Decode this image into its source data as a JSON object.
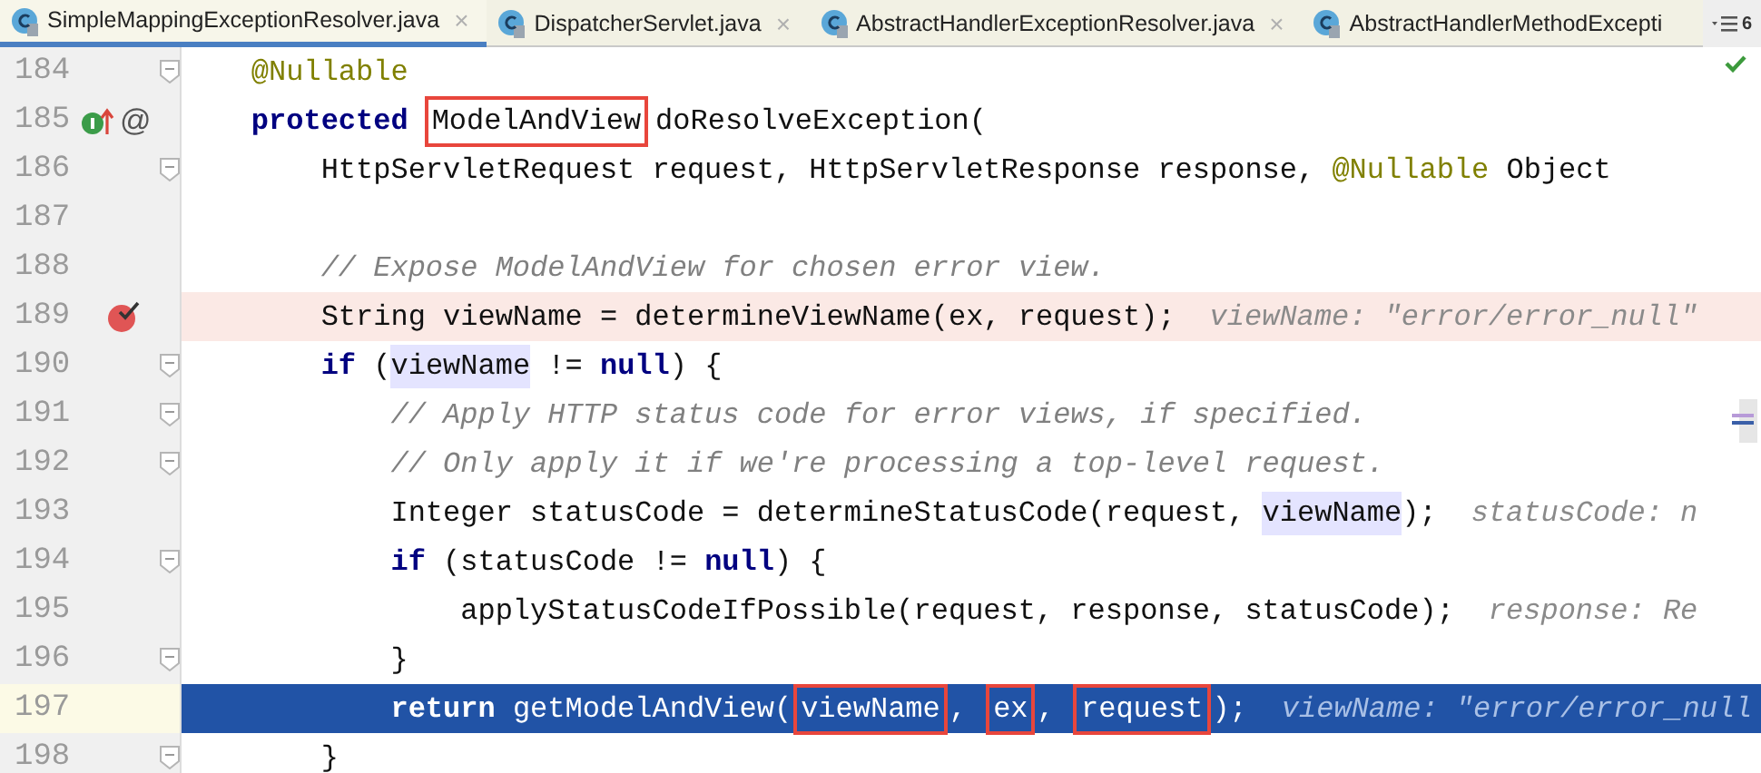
{
  "tabs": [
    {
      "label": "SimpleMappingExceptionResolver.java",
      "selected": true,
      "closable": true
    },
    {
      "label": "DispatcherServlet.java",
      "selected": false,
      "closable": true
    },
    {
      "label": "AbstractHandlerExceptionResolver.java",
      "selected": false,
      "closable": true
    },
    {
      "label": "AbstractHandlerMethodExcepti",
      "selected": false,
      "closable": false
    }
  ],
  "hidden_tab_count": "6",
  "close_glyph": "×",
  "lines": [
    {
      "number": "184",
      "breakpoint": false,
      "current": false,
      "overrides": false,
      "fold": true,
      "segments": [
        {
          "kind": "annotation",
          "text": "    @Nullable"
        }
      ]
    },
    {
      "number": "185",
      "breakpoint": false,
      "current": false,
      "overrides": true,
      "marker_text": "@",
      "fold": false,
      "segments": [
        {
          "kind": "keyword",
          "text": "    protected"
        },
        {
          "kind": "boxed",
          "text": "ModelAndView"
        },
        {
          "kind": "plain",
          "text": "doResolveException("
        }
      ]
    },
    {
      "number": "186",
      "breakpoint": false,
      "current": false,
      "overrides": false,
      "fold": true,
      "segments": [
        {
          "kind": "plain",
          "text": "        HttpServletRequest request, HttpServletResponse response, "
        },
        {
          "kind": "annotation",
          "text": "@Nullable"
        },
        {
          "kind": "plain",
          "text": " Object"
        }
      ]
    },
    {
      "number": "187",
      "breakpoint": false,
      "current": false,
      "overrides": false,
      "fold": false
    },
    {
      "number": "188",
      "breakpoint": false,
      "current": false,
      "overrides": false,
      "fold": false,
      "segments": [
        {
          "kind": "comment",
          "text": "        // Expose ModelAndView for chosen error view."
        }
      ]
    },
    {
      "number": "189",
      "breakpoint": true,
      "current": false,
      "overrides": false,
      "fold": false,
      "segments": [
        {
          "kind": "plain",
          "text": "        String viewName = determineViewName(ex, request);"
        },
        {
          "kind": "hint",
          "text": "viewName: \"error/error_null\""
        }
      ]
    },
    {
      "number": "190",
      "breakpoint": false,
      "current": false,
      "overrides": false,
      "fold": true,
      "segments": [
        {
          "kind": "keyword",
          "text": "        if"
        },
        {
          "kind": "plain",
          "text": " ("
        },
        {
          "kind": "usage",
          "text": "viewName"
        },
        {
          "kind": "plain",
          "text": " != "
        },
        {
          "kind": "keyword",
          "text": "null"
        },
        {
          "kind": "plain",
          "text": ") {"
        }
      ]
    },
    {
      "number": "191",
      "breakpoint": false,
      "current": false,
      "overrides": false,
      "fold": true,
      "segments": [
        {
          "kind": "comment",
          "text": "            // Apply HTTP status code for error views, if specified."
        }
      ]
    },
    {
      "number": "192",
      "breakpoint": false,
      "current": false,
      "overrides": false,
      "fold": true,
      "segments": [
        {
          "kind": "comment",
          "text": "            // Only apply it if we're processing a top-level request."
        }
      ]
    },
    {
      "number": "193",
      "breakpoint": false,
      "current": false,
      "overrides": false,
      "fold": false,
      "segments": [
        {
          "kind": "plain",
          "text": "            Integer statusCode = determineStatusCode(request, "
        },
        {
          "kind": "usage",
          "text": "viewName"
        },
        {
          "kind": "plain",
          "text": ");"
        },
        {
          "kind": "hint",
          "text": "statusCode: n"
        }
      ]
    },
    {
      "number": "194",
      "breakpoint": false,
      "current": false,
      "overrides": false,
      "fold": true,
      "segments": [
        {
          "kind": "keyword",
          "text": "            if"
        },
        {
          "kind": "plain",
          "text": " (statusCode != "
        },
        {
          "kind": "keyword",
          "text": "null"
        },
        {
          "kind": "plain",
          "text": ") {"
        }
      ]
    },
    {
      "number": "195",
      "breakpoint": false,
      "current": false,
      "overrides": false,
      "fold": false,
      "segments": [
        {
          "kind": "plain",
          "text": "                applyStatusCodeIfPossible(request, response, statusCode);"
        },
        {
          "kind": "hint",
          "text": "response: Re"
        }
      ]
    },
    {
      "number": "196",
      "breakpoint": false,
      "current": false,
      "overrides": false,
      "fold": true,
      "segments": [
        {
          "kind": "plain",
          "text": "            }"
        }
      ]
    },
    {
      "number": "197",
      "breakpoint": false,
      "current": true,
      "overrides": false,
      "fold": false,
      "segments": [
        {
          "kind": "keyword",
          "text": "            return"
        },
        {
          "kind": "plain",
          "text": " getModelAndView("
        },
        {
          "kind": "boxed",
          "text": "viewName"
        },
        {
          "kind": "plain",
          "text": ", "
        },
        {
          "kind": "boxed",
          "text": "ex"
        },
        {
          "kind": "plain",
          "text": ", "
        },
        {
          "kind": "boxed",
          "text": "request"
        },
        {
          "kind": "plain",
          "text": ");"
        },
        {
          "kind": "hint",
          "text": "viewName: \"error/error_null"
        }
      ]
    },
    {
      "number": "198",
      "breakpoint": false,
      "current": false,
      "overrides": false,
      "fold": true,
      "segments": [
        {
          "kind": "plain",
          "text": "        }"
        }
      ]
    }
  ]
}
